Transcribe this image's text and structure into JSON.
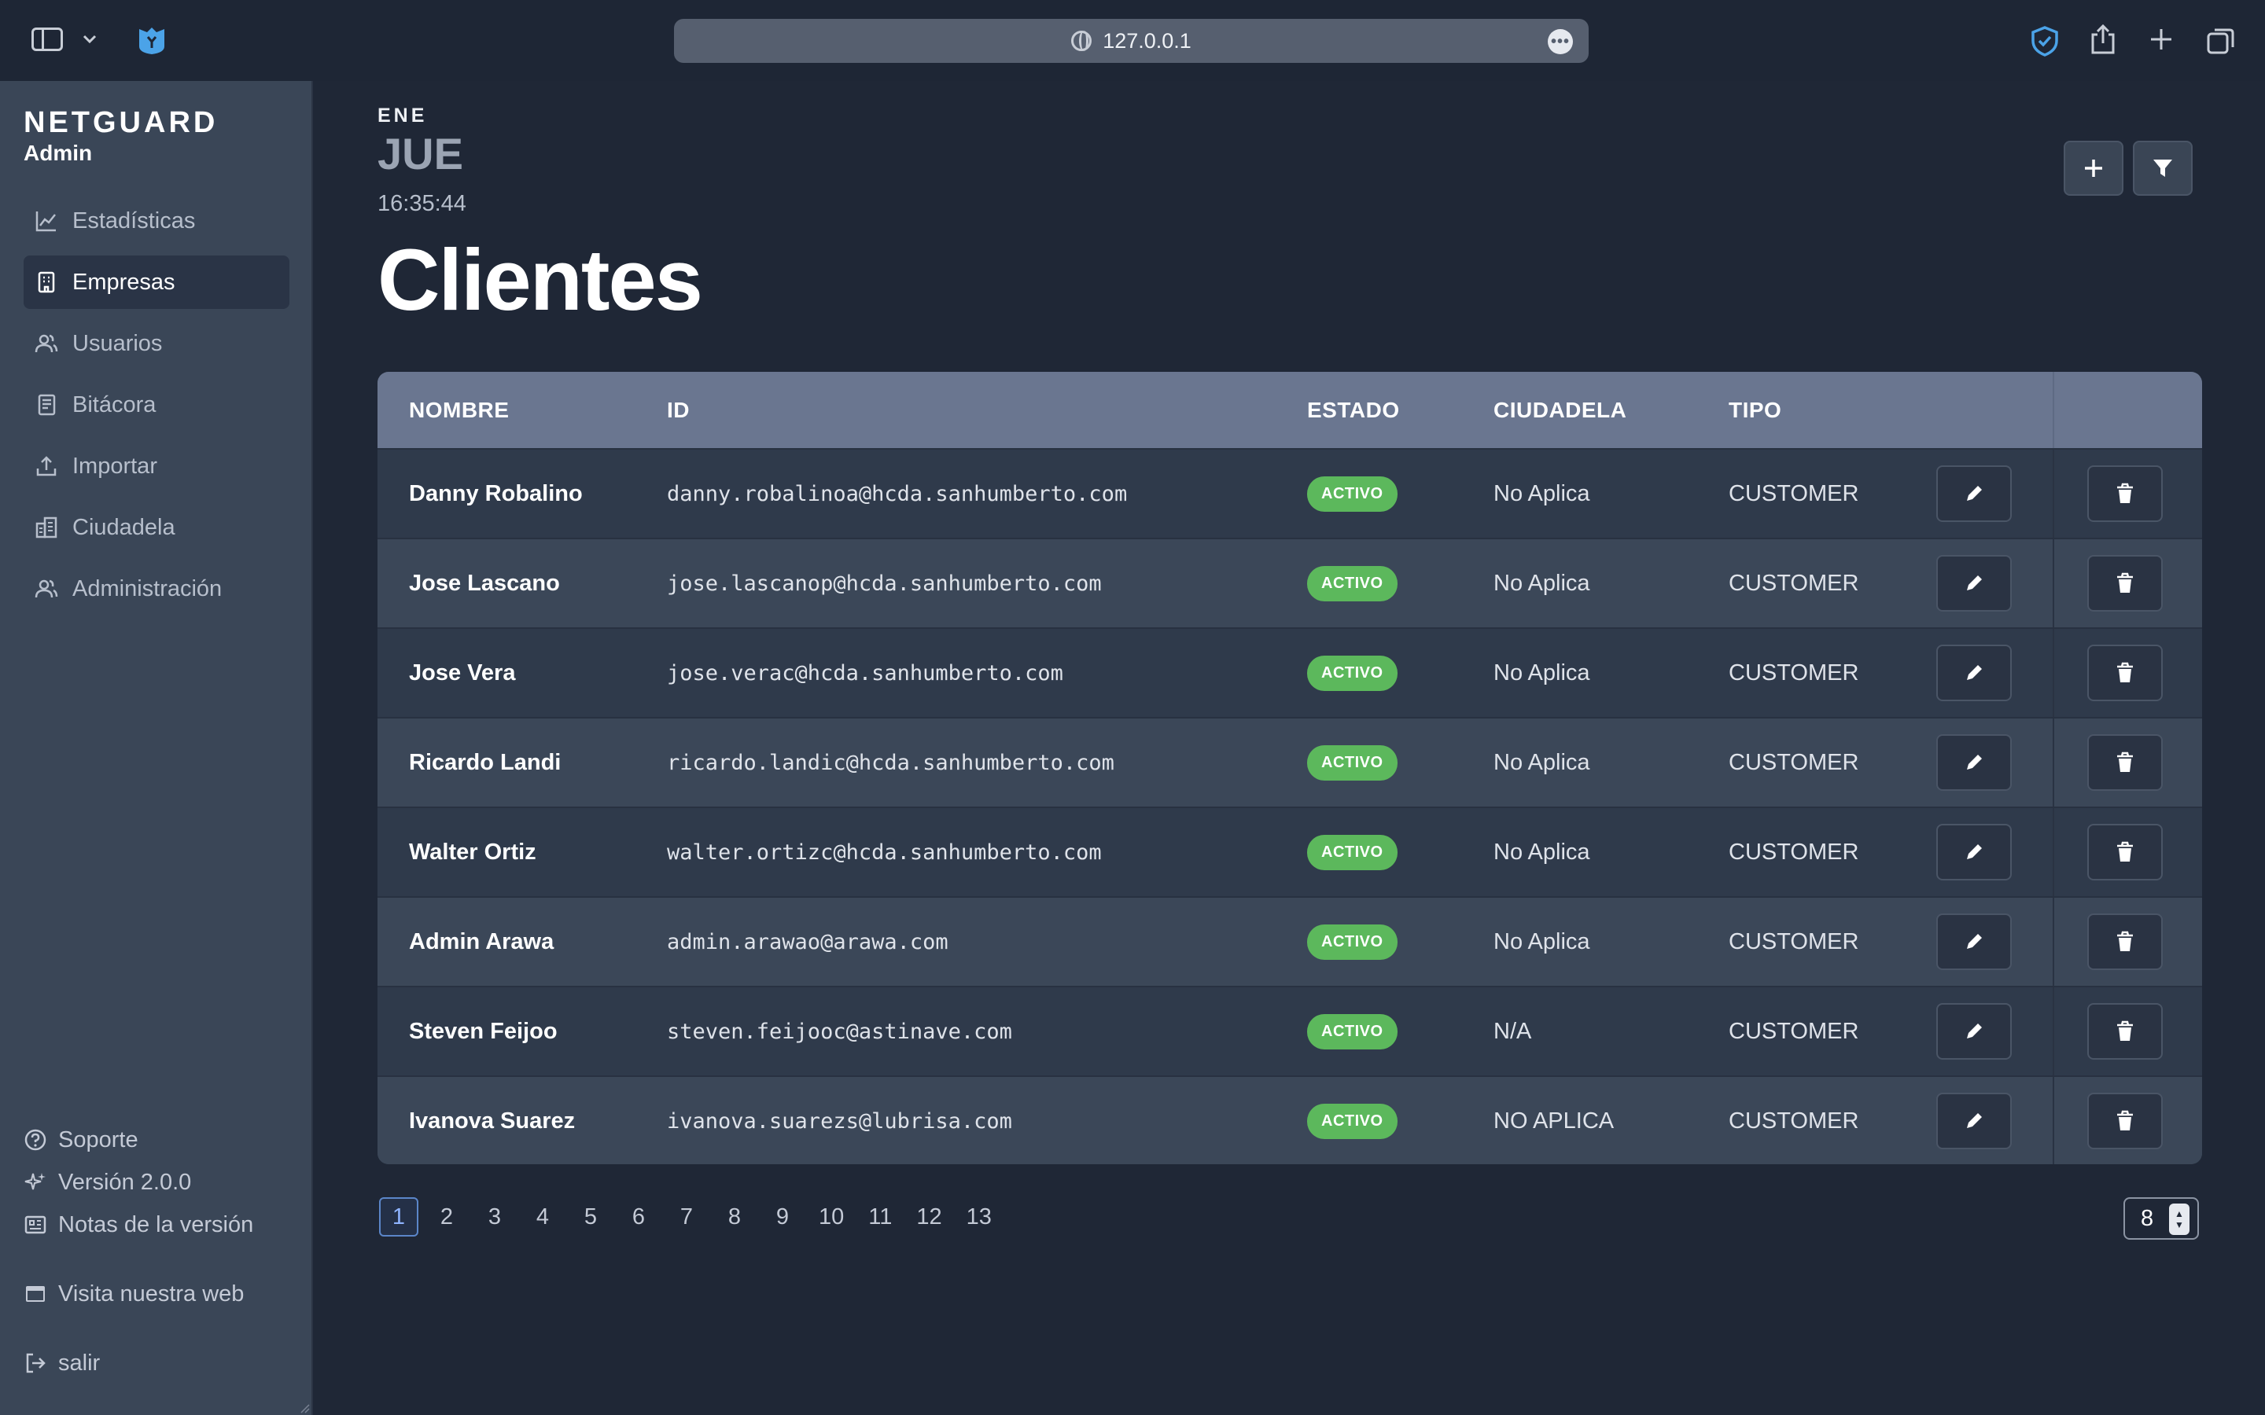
{
  "browser": {
    "url": "127.0.0.1"
  },
  "sidebar": {
    "logo": "NETGUARD",
    "role": "Admin",
    "items": [
      {
        "label": "Estadísticas",
        "icon": "chart-line-icon"
      },
      {
        "label": "Empresas",
        "icon": "building-icon",
        "active": true
      },
      {
        "label": "Usuarios",
        "icon": "users-icon"
      },
      {
        "label": "Bitácora",
        "icon": "book-icon"
      },
      {
        "label": "Importar",
        "icon": "upload-icon"
      },
      {
        "label": "Ciudadela",
        "icon": "buildings-icon"
      },
      {
        "label": "Administración",
        "icon": "user-group-icon"
      }
    ],
    "support": "Soporte",
    "version": "Versión 2.0.0",
    "release_notes": "Notas de la versión",
    "website": "Visita nuestra web",
    "logout": "salir"
  },
  "header": {
    "month": "ENE",
    "weekday": "JUE",
    "time": "16:35:44",
    "title": "Clientes"
  },
  "table": {
    "columns": [
      "NOMBRE",
      "ID",
      "ESTADO",
      "CIUDADELA",
      "TIPO"
    ],
    "rows": [
      {
        "name": "Danny Robalino",
        "id": "danny.robalinoa@hcda.sanhumberto.com",
        "estado": "ACTIVO",
        "ciudadela": "No Aplica",
        "tipo": "CUSTOMER"
      },
      {
        "name": "Jose Lascano",
        "id": "jose.lascanop@hcda.sanhumberto.com",
        "estado": "ACTIVO",
        "ciudadela": "No Aplica",
        "tipo": "CUSTOMER"
      },
      {
        "name": "Jose Vera",
        "id": "jose.verac@hcda.sanhumberto.com",
        "estado": "ACTIVO",
        "ciudadela": "No Aplica",
        "tipo": "CUSTOMER"
      },
      {
        "name": "Ricardo Landi",
        "id": "ricardo.landic@hcda.sanhumberto.com",
        "estado": "ACTIVO",
        "ciudadela": "No Aplica",
        "tipo": "CUSTOMER"
      },
      {
        "name": "Walter Ortiz",
        "id": "walter.ortizc@hcda.sanhumberto.com",
        "estado": "ACTIVO",
        "ciudadela": "No Aplica",
        "tipo": "CUSTOMER"
      },
      {
        "name": "Admin Arawa",
        "id": "admin.arawao@arawa.com",
        "estado": "ACTIVO",
        "ciudadela": "No Aplica",
        "tipo": "CUSTOMER"
      },
      {
        "name": "Steven Feijoo",
        "id": "steven.feijooc@astinave.com",
        "estado": "ACTIVO",
        "ciudadela": "N/A",
        "tipo": "CUSTOMER"
      },
      {
        "name": "Ivanova Suarez",
        "id": "ivanova.suarezs@lubrisa.com",
        "estado": "ACTIVO",
        "ciudadela": "NO APLICA",
        "tipo": "CUSTOMER"
      }
    ]
  },
  "pagination": {
    "pages": [
      "1",
      "2",
      "3",
      "4",
      "5",
      "6",
      "7",
      "8",
      "9",
      "10",
      "11",
      "12",
      "13"
    ],
    "current": "1",
    "per_page": "8"
  },
  "colors": {
    "background": "#1f2736",
    "sidebar": "#3a4657",
    "table_header": "#6a7690",
    "badge_active": "#5cb85c",
    "pager_current": "#5b86c9"
  }
}
